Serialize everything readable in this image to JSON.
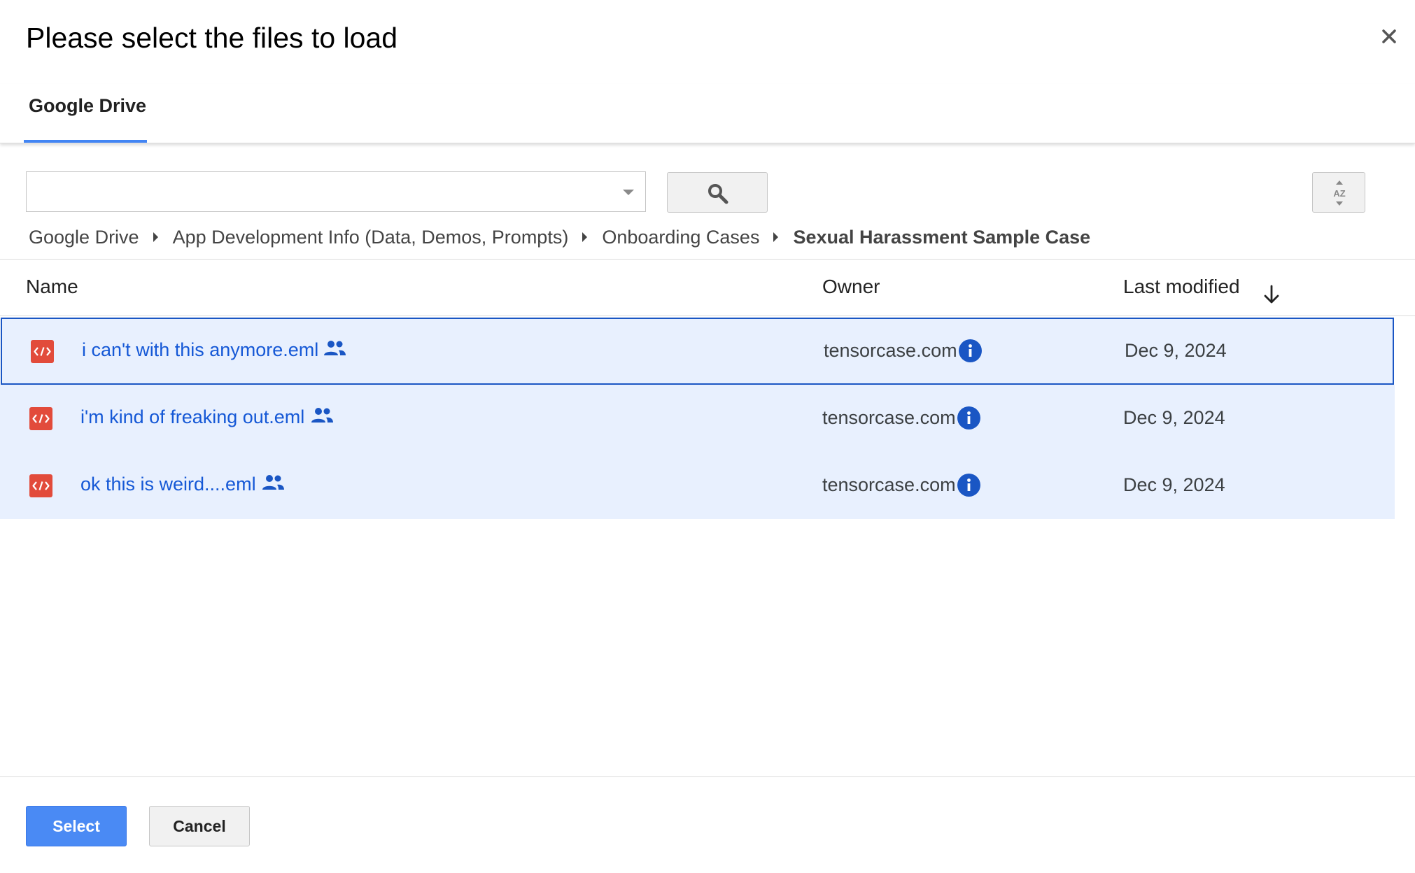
{
  "dialog": {
    "title": "Please select the files to load",
    "close_label": "×"
  },
  "tabs": [
    {
      "label": "Google Drive",
      "active": true
    }
  ],
  "search": {
    "value": "",
    "placeholder": ""
  },
  "breadcrumb": [
    {
      "label": "Google Drive"
    },
    {
      "label": "App Development Info (Data, Demos, Prompts)"
    },
    {
      "label": "Onboarding Cases"
    },
    {
      "label": "Sexual Harassment Sample Case",
      "current": true
    }
  ],
  "table": {
    "columns": {
      "name": "Name",
      "owner": "Owner",
      "last_modified": "Last modified"
    },
    "sort": {
      "column": "last_modified",
      "direction": "descending"
    },
    "rows": [
      {
        "name": "i can't with this anymore.eml",
        "owner": "tensorcase.com",
        "modified": "Dec 9, 2024",
        "shared": true,
        "selected": true,
        "focused": true
      },
      {
        "name": "i'm kind of freaking out.eml",
        "owner": "tensorcase.com",
        "modified": "Dec 9, 2024",
        "shared": true,
        "selected": true,
        "focused": false
      },
      {
        "name": "ok this is weird....eml",
        "owner": "tensorcase.com",
        "modified": "Dec 9, 2024",
        "shared": true,
        "selected": true,
        "focused": false
      }
    ]
  },
  "footer": {
    "select_label": "Select",
    "cancel_label": "Cancel"
  },
  "colors": {
    "accent": "#4285f4",
    "selected_row": "#e8f0fe",
    "link": "#1558d6",
    "file_icon": "#e24b3b"
  },
  "icons": {
    "close": "close-icon",
    "dropdown": "chevron-down-icon",
    "search": "search-icon",
    "sort": "sort-az-icon",
    "file": "code-file-icon",
    "shared": "shared-people-icon",
    "info": "info-icon",
    "sort_direction": "arrow-down-icon"
  }
}
